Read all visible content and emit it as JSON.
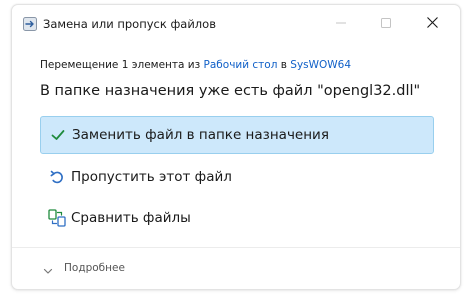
{
  "window": {
    "title": "Замена или пропуск файлов",
    "icon": "file-transfer-icon"
  },
  "subtitle": {
    "prefix": "Перемещение 1 элемента из ",
    "source": "Рабочий стол",
    "middle": " в ",
    "destination": "SysWOW64"
  },
  "heading": "В папке назначения уже есть файл \"opengl32.dll\"",
  "options": [
    {
      "label": "Заменить файл в папке назначения",
      "icon": "checkmark-icon",
      "selected": true
    },
    {
      "label": "Пропустить этот файл",
      "icon": "undo-arrow-icon",
      "selected": false
    },
    {
      "label": "Сравнить файлы",
      "icon": "compare-files-icon",
      "selected": false
    }
  ],
  "footer": {
    "more_label": "Подробнее",
    "icon": "chevron-down-icon"
  },
  "colors": {
    "accent": "#1060c8",
    "selected_bg": "#cde8fb",
    "selected_border": "#99cfee",
    "check_green": "#1e8a3c"
  }
}
